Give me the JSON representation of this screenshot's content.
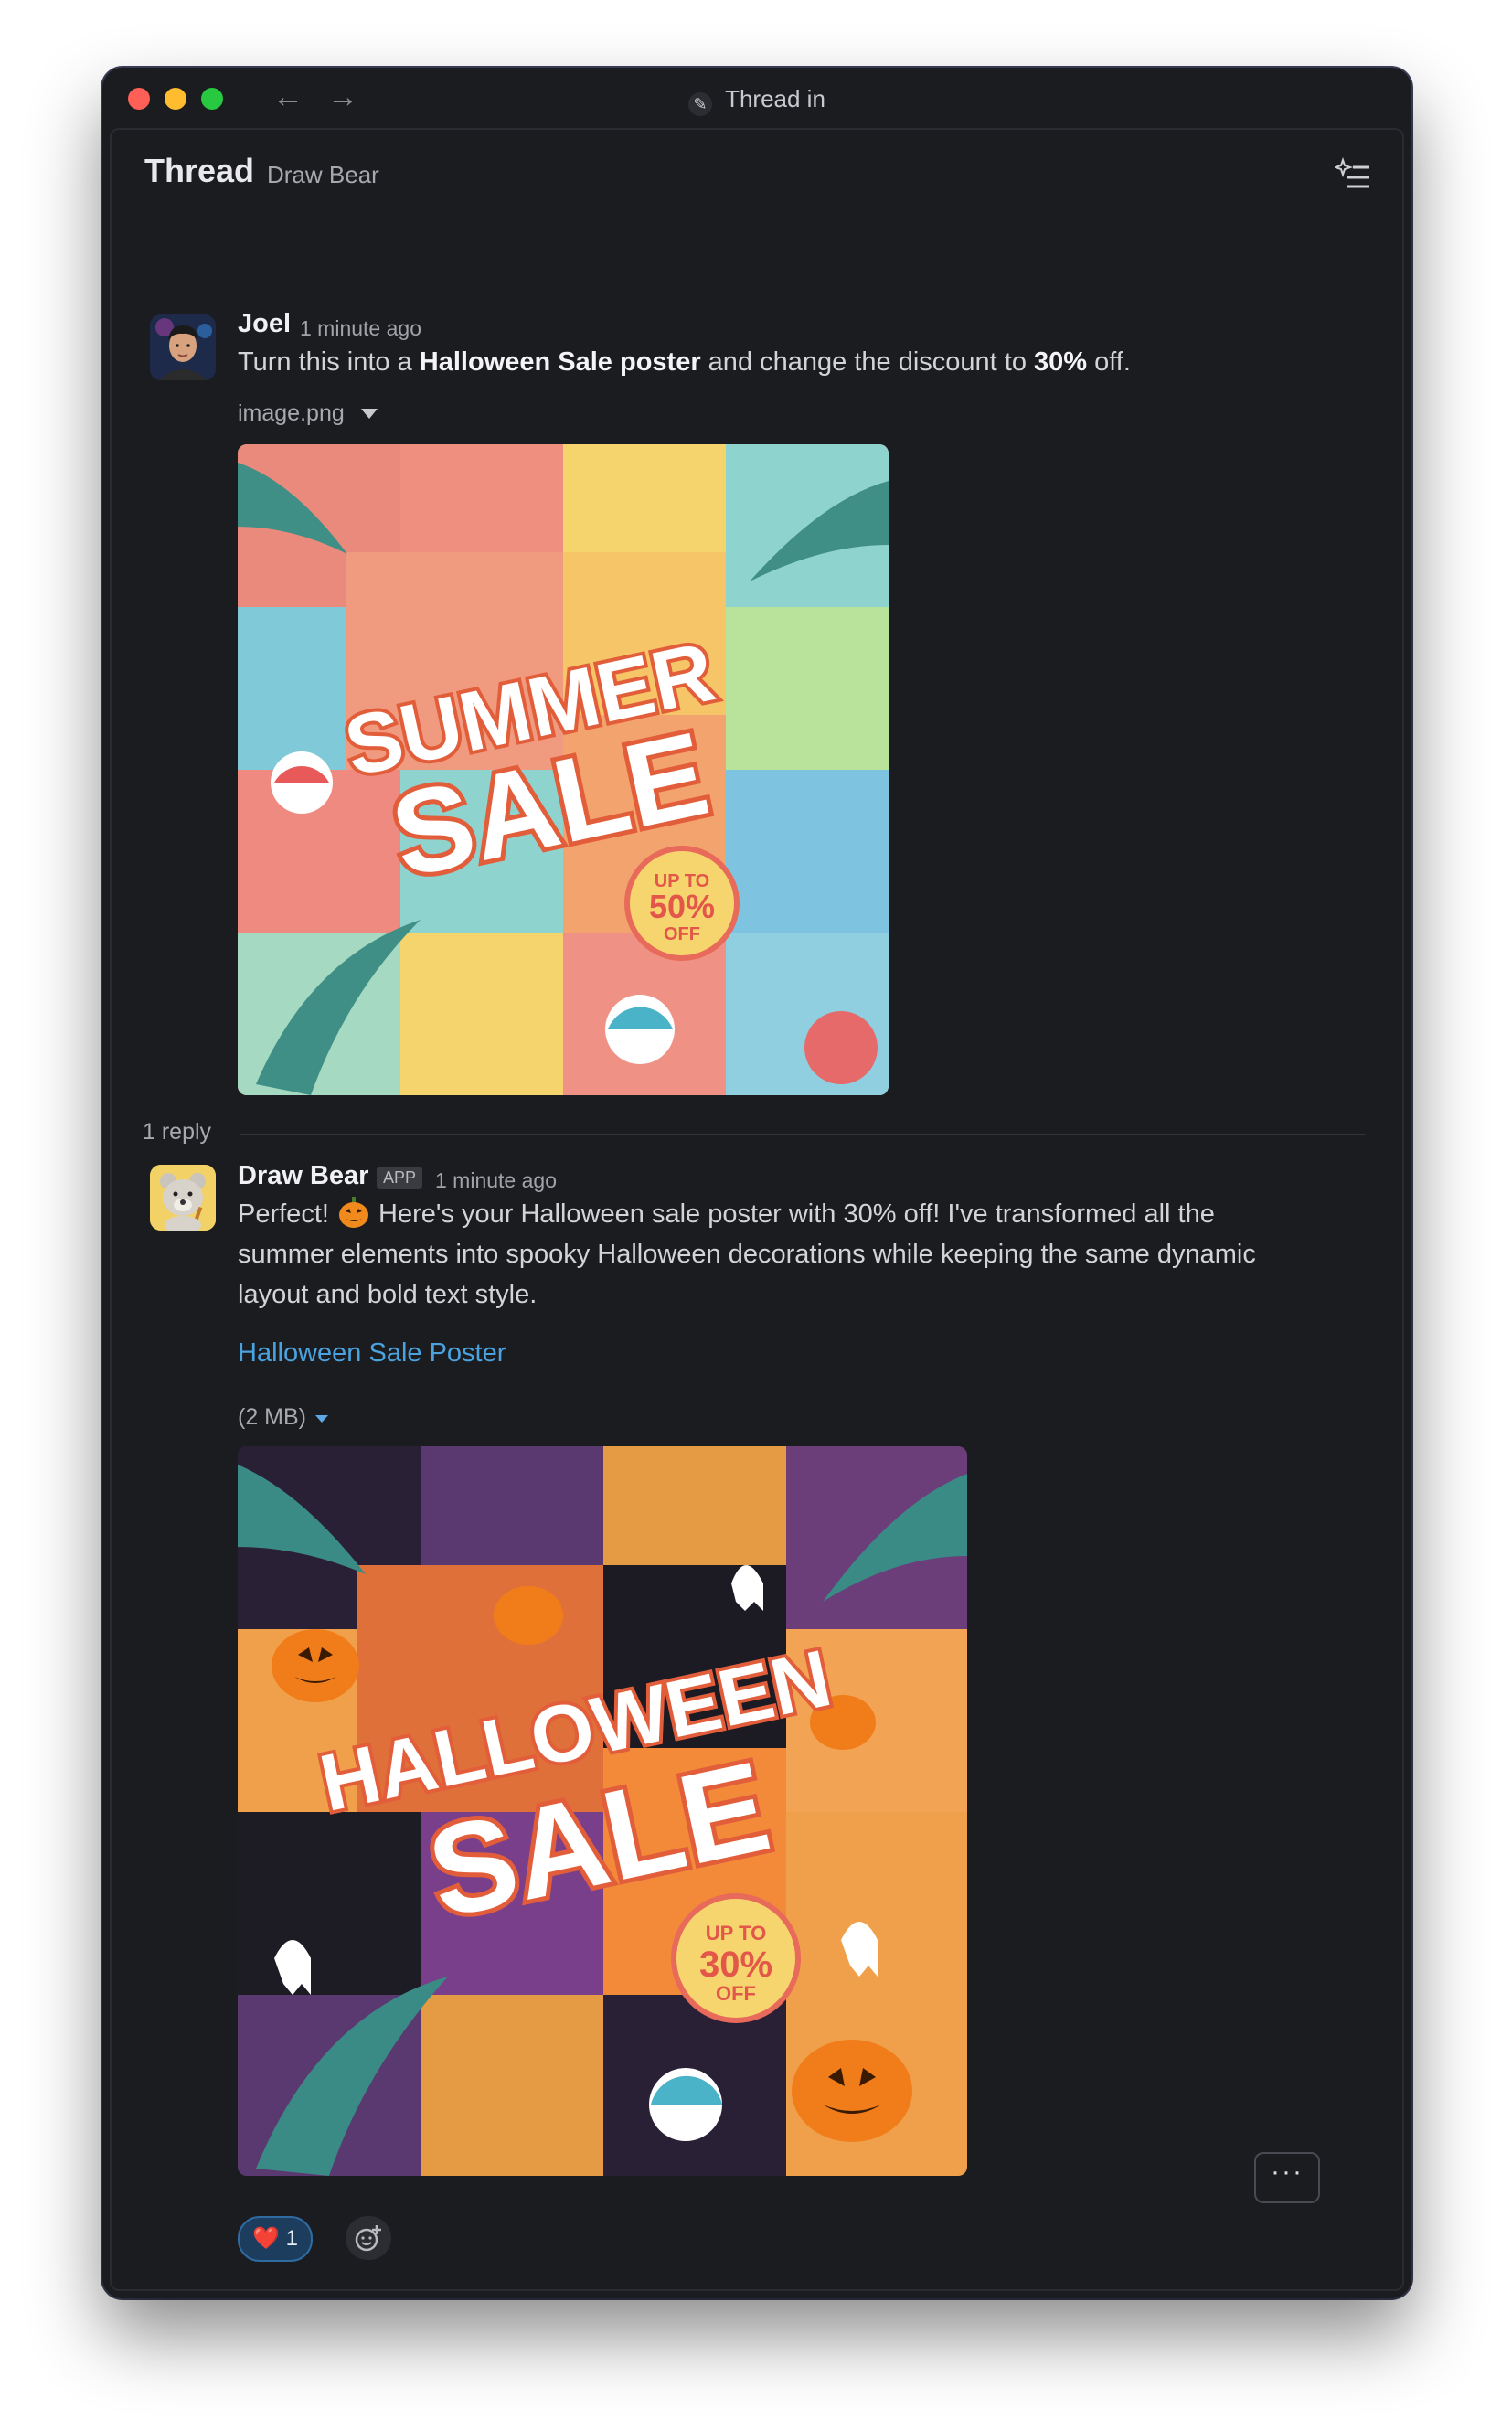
{
  "window": {
    "title": "Thread in"
  },
  "thread": {
    "title": "Thread",
    "subtitle": "Draw Bear"
  },
  "message1": {
    "author": "Joel",
    "time": "1 minute ago",
    "text_a": "Turn this into a ",
    "text_b": "Halloween Sale poster",
    "text_c": " and change the discount to ",
    "text_d": "30%",
    "text_e": " off.",
    "file_name": "image.png",
    "poster": {
      "line1": "SUMMER",
      "line2": "SALE",
      "badge1": "UP TO",
      "badge2": "50%",
      "badge3": "OFF"
    }
  },
  "replies_label": "1 reply",
  "message2": {
    "author": "Draw Bear",
    "badge": "APP",
    "time": "1 minute ago",
    "line1_a": "Perfect! ",
    "line1_b": " Here's your Halloween sale poster with 30% off! I've transformed all the",
    "line2": "summer elements into spooky Halloween decorations while keeping the same dynamic",
    "line3": "layout and bold text style.",
    "link": "Halloween Sale Poster",
    "file_size": "(2 MB)",
    "poster": {
      "line1": "HALLOWEEN",
      "line2": "SALE",
      "badge1": "UP TO",
      "badge2": "30%",
      "badge3": "OFF"
    }
  },
  "more_button": "···",
  "reaction": {
    "emoji": "❤️",
    "count": "1"
  },
  "colors": {
    "background": "#1b1c20",
    "link": "#4aa3df",
    "reaction": "#1d3d5f"
  },
  "icons": [
    "back-arrow-icon",
    "forward-arrow-icon",
    "thread-options-icon",
    "pumpkin-emoji-icon",
    "add-reaction-icon"
  ]
}
